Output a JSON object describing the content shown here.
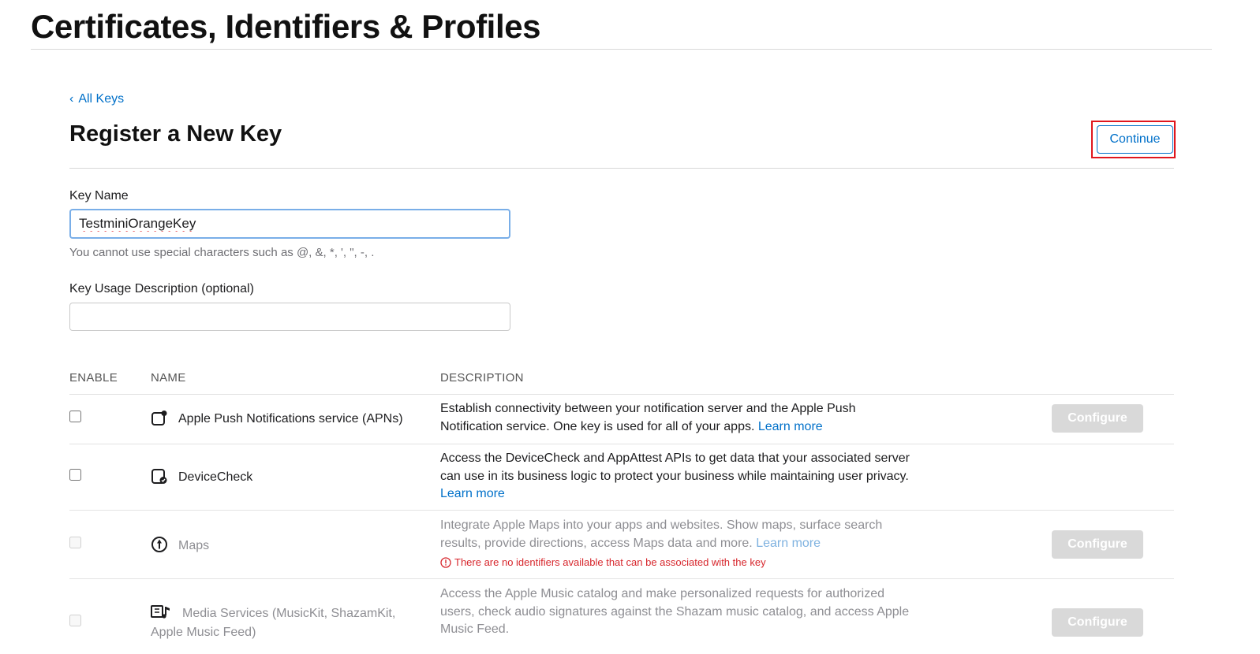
{
  "header": {
    "title": "Certificates, Identifiers & Profiles"
  },
  "nav": {
    "back_label": "All Keys"
  },
  "section": {
    "title": "Register a New Key",
    "continue_label": "Continue"
  },
  "form": {
    "key_name_label": "Key Name",
    "key_name_value": "TestminiOrangeKey",
    "key_name_hint": "You cannot use special characters such as @, &, *, ', \", -, .",
    "description_label": "Key Usage Description (optional)",
    "description_value": ""
  },
  "table": {
    "headers": {
      "enable": "ENABLE",
      "name": "NAME",
      "description": "DESCRIPTION"
    },
    "rows": [
      {
        "name": "Apple Push Notifications service (APNs)",
        "icon": "push-notification-icon",
        "description": "Establish connectivity between your notification server and the Apple Push Notification service. One key is used for all of your apps.",
        "learn_more": "Learn more",
        "configure_label": "Configure",
        "enabled": false,
        "disabled": false
      },
      {
        "name": "DeviceCheck",
        "icon": "device-check-icon",
        "description": "Access the DeviceCheck and AppAttest APIs to get data that your associated server can use in its business logic to protect your business while maintaining user privacy.",
        "learn_more": "Learn more",
        "enabled": false,
        "disabled": false
      },
      {
        "name": "Maps",
        "icon": "maps-icon",
        "description": "Integrate Apple Maps into your apps and websites. Show maps, surface search results, provide directions, access Maps data and more.",
        "learn_more": "Learn more",
        "warning": "There are no identifiers available that can be associated with the key",
        "configure_label": "Configure",
        "enabled": false,
        "disabled": true
      },
      {
        "name": "Media Services (MusicKit, ShazamKit, Apple Music Feed)",
        "icon": "media-services-icon",
        "description": "Access the Apple Music catalog and make personalized requests for authorized users, check audio signatures against the Shazam music catalog, and access Apple Music Feed.",
        "configure_label": "Configure",
        "enabled": false,
        "disabled": true
      }
    ]
  },
  "colors": {
    "accent": "#0070c9",
    "highlight": "#e0161d",
    "warning": "#d7262c",
    "disabled_button": "#d9d9d9"
  }
}
